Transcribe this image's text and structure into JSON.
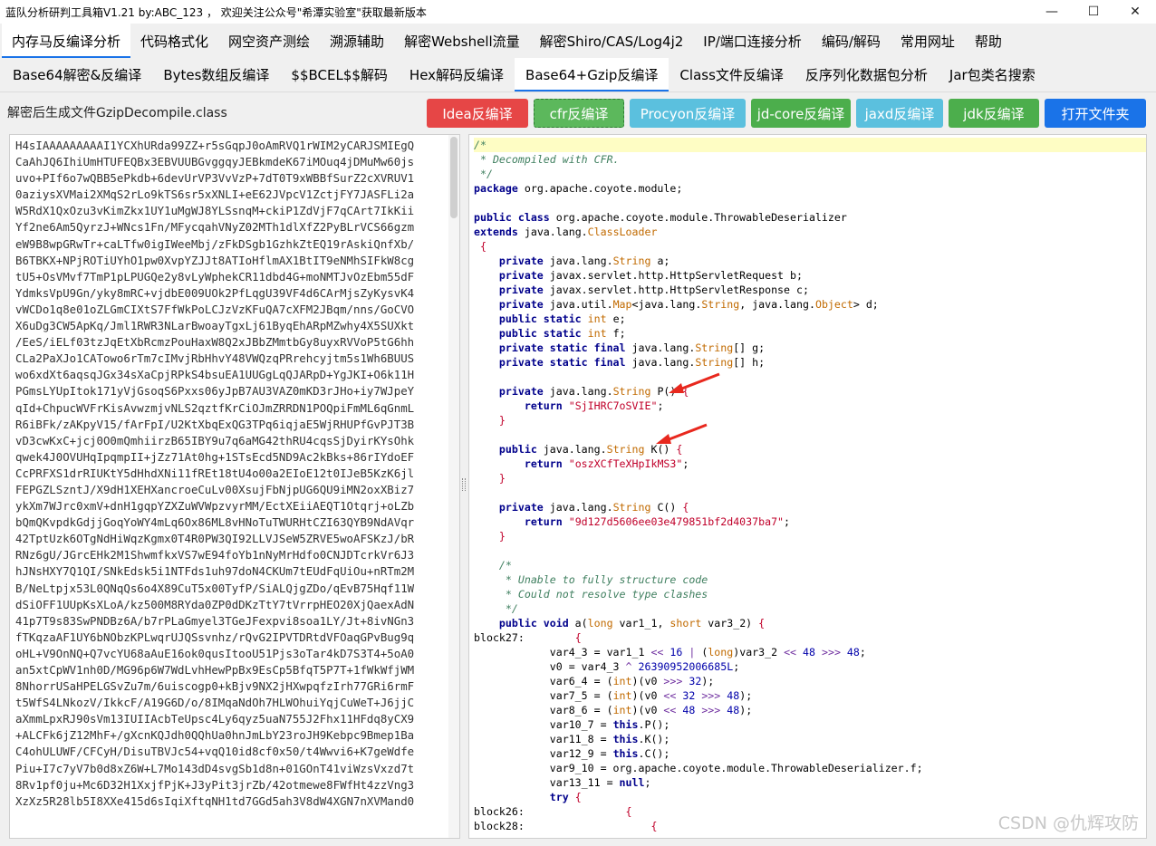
{
  "window": {
    "title": "蓝队分析研判工具箱V1.21 by:ABC_123 ， 欢迎关注公众号\"希潭实验室\"获取最新版本",
    "controls": [
      "—",
      "☐",
      "✕"
    ]
  },
  "menu": [
    "内存马反编译分析",
    "代码格式化",
    "网空资产测绘",
    "溯源辅助",
    "解密Webshell流量",
    "解密Shiro/CAS/Log4j2",
    "IP/端口连接分析",
    "编码/解码",
    "常用网址",
    "帮助"
  ],
  "tabs": [
    "Base64解密&反编译",
    "Bytes数组反编译",
    "$$BCEL$$解码",
    "Hex解码反编译",
    "Base64+Gzip反编译",
    "Class文件反编译",
    "反序列化数据包分析",
    "Jar包类名搜索"
  ],
  "output_label": "解密后生成文件GzipDecompile.class",
  "buttons": [
    {
      "label": "Idea反编译",
      "color": "#e64646",
      "border": "#e64646"
    },
    {
      "label": "cfr反编译",
      "color": "#5cb85c",
      "border": "#2e7d32"
    },
    {
      "label": "Procyon反编译",
      "color": "#5bc0de",
      "border": "#5bc0de"
    },
    {
      "label": "jd-core反编译",
      "color": "#4cae4c",
      "border": "#4cae4c"
    },
    {
      "label": "jaxd反编译",
      "color": "#5bc0de",
      "border": "#5bc0de"
    },
    {
      "label": "jdk反编译",
      "color": "#4cae4c",
      "border": "#4cae4c"
    },
    {
      "label": "打开文件夹",
      "color": "#1a73e8",
      "border": "#1a73e8"
    }
  ],
  "input_text": [
    "H4sIAAAAAAAAAI1YCXhURda99ZZ+r5sGqpJ0oAmRVQ1rWIM2yCARJSMIEgQ",
    "CaAhJQ6IhiUmHTUFEQBx3EBVUUBGvggqyJEBkmdeK67iMOuq4jDMuMw60js",
    "uvo+PIf6o7wQBB5ePkdb+6devUrVP3VvVzP+7dT0T9xWBBfSurZ2cXVRUV1",
    "0aziysXVMai2XMqS2rLo9kTS6sr5xXNLI+eE62JVpcV1ZctjFY7JASFLi2a",
    "W5RdX1QxOzu3vKimZkx1UY1uMgWJ8YLSsnqM+ckiP1ZdVjF7qCArt7IkKii",
    "Yf2ne6Am5QyrzJ+WNcs1Fn/MFycqahVNyZ02MTh1dlXfZ2PyBLrVCS66gzm",
    "eW9B8wpGRwTr+caLTfw0igIWeeMbj/zFkDSgb1GzhkZtEQ19rAskiQnfXb/",
    "B6TBKX+NPjROTiUYhO1pw0XvpYZJJt8ATIoHflmAX1BtIT9eNMhSIFkW8cg",
    "tU5+OsVMvf7TmP1pLPUGQe2y8vLyWphekCR11dbd4G+moNMTJvOzEbm55dF",
    "YdmksVpU9Gn/yky8mRC+vjdbE009UOk2PfLqgU39VF4d6CArMjsZyKysvK4",
    "vWCDo1q8e01oZLGmCIXtS7FfWkPoLCJzVzKFuQA7cXFM2JBqm/nns/GoCVO",
    "X6uDg3CW5ApKq/Jml1RWR3NLarBwoayTgxLj61ByqEhARpMZwhy4X5SUXkt",
    "/EeS/iELf03tzJqEtXbRcmzPouHaxW8Q2xJBbZMmtbGy8uyxRVVoP5tG6hh",
    "CLa2PaXJo1CATowo6rTm7cIMvjRbHhvY48VWQzqPRrehcyjtm5s1Wh6BUUS",
    "wo6xdXt6aqsqJGx34sXaCpjRPkS4bsuEA1UUGgLqQJARpD+YgJKI+O6k11H",
    "PGmsLYUpItok171yVjGsoqS6Pxxs06yJpB7AU3VAZ0mKD3rJHo+iy7WJpeY",
    "qId+ChpucWVFrKisAvwzmjvNLS2qztfKrCiOJmZRRDN1POQpiFmML6qGnmL",
    "R6iBFk/zAKpyV15/fArFpI/U2KtXbqExQG3TPq6iqjaE5WjRHUPfGvPJT3B",
    "vD3cwKxC+jcj0O0mQmhiirzB65IBY9u7q6aMG42thRU4cqsSjDyirKYsOhk",
    "qwek4J0OVUHqIpqmpII+jZz71At0hg+1STsEcd5ND9Ac2kBks+86rIYdoEF",
    "CcPRFXS1drRIUKtY5dHhdXNi11fREt18tU4o00a2EIoE12t0IJeB5KzK6jl",
    "FEPGZLSzntJ/X9dH1XEHXancroeCuLv00XsujFbNjpUG6QU9iMN2oxXBiz7",
    "ykXm7WJrc0xmV+dnH1gqpYZXZuWVWpzvyrMM/EctXEiiAEQT1Otqrj+oLZb",
    "bQmQKvpdkGdjjGoqYoWY4mLq6Ox86ML8vHNoTuTWURHtCZI63QYB9NdAVqr",
    "42TptUzk6OTgNdHiWqzKgmx0T4R0PW3QI92LLVJSeW5ZRVE5woAFSKzJ/bR",
    "RNz6gU/JGrcEHk2M1ShwmfkxVS7wE94foYb1nNyMrHdfo0CNJDTcrkVr6J3",
    "hJNsHXY7Q1QI/SNkEdsk5i1NTFds1uh97doN4CKUm7tEUdFqUiOu+nRTm2M",
    "B/NeLtpjx53L0QNqQs6o4X89CuT5x00TyfP/SiALQjgZDo/qEvB75Hqf11W",
    "dSiOFF1UUpKsXLoA/kz500M8RYda0ZP0dDKzTtY7tVrrpHEO20XjQaexAdN",
    "41p7T9s83SwPNDBz6A/b7rPLaGmyel3TGeJFexpvi8soa1LY/Jt+8ivNGn3",
    "fTKqzaAF1UY6bNObzKPLwqrUJQSsvnhz/rQvG2IPVTDRtdVFOaqGPvBug9q",
    "oHL+V9OnNQ+Q7vcYU68aAuE16ok0qusItooU51Pjs3oTar4kD7S3T4+5oA0",
    "an5xtCpWV1nh0D/MG96p6W7WdLvhHewPpBx9EsCp5BfqT5P7T+1fWkWfjWM",
    "8NhorrUSaHPELGSvZu7m/6uiscogp0+kBjv9NX2jHXwpqfzIrh77GRi6rmF",
    "t5WfS4LNkozV/IkkcF/A19G6D/o/8IMqaNdOh7HLWOhuiYqjCuWeT+J6jjC",
    "aXmmLpxRJ90sVm13IUIIAcbTeUpsc4Ly6qyz5uaN755J2Fhx11HFdq8yCX9",
    "+ALCFk6jZ12MhF+/gXcnKQJdh0QQhUa0hnJmLbY23roJH9Kebpc9Bmep1Ba",
    "C4ohULUWF/CFCyH/DisuTBVJc54+vqQ10id8cf0x50/t4Wwvi6+K7geWdfe",
    "Piu+I7c7yV7b0d8xZ6W+L7Mo143dD4svgSb1d8n+01GOnT41viWzsVxzd7t",
    "8Rv1pf0ju+Mc6D32H1XxjfPjK+J3yPit3jrZb/42otmewe8FWfHt4zzVng3",
    "XzXz5R28lb5I8XXe415d6sIqiXftqNH1td7GGd5ah3V8dW4XGN7nXVMand0"
  ],
  "code_lines": [
    [
      [
        "cm",
        "/*"
      ]
    ],
    [
      [
        "cm",
        " * Decompiled with CFR."
      ]
    ],
    [
      [
        "cm",
        " */"
      ]
    ],
    [
      [
        "kw",
        "package"
      ],
      [
        "p",
        " org.apache.coyote.module;"
      ]
    ],
    [],
    [
      [
        "kw",
        "public class"
      ],
      [
        "p",
        " org.apache.coyote.module.ThrowableDeserializer"
      ]
    ],
    [
      [
        "kw",
        "extends"
      ],
      [
        "p",
        " java.lang."
      ],
      [
        "ty",
        "ClassLoader"
      ]
    ],
    [
      [
        "st",
        " {"
      ]
    ],
    [
      [
        "p",
        "    "
      ],
      [
        "kw",
        "private"
      ],
      [
        "p",
        " java.lang."
      ],
      [
        "ty",
        "String"
      ],
      [
        "p",
        " a;"
      ]
    ],
    [
      [
        "p",
        "    "
      ],
      [
        "kw",
        "private"
      ],
      [
        "p",
        " javax.servlet.http.HttpServletRequest b;"
      ]
    ],
    [
      [
        "p",
        "    "
      ],
      [
        "kw",
        "private"
      ],
      [
        "p",
        " javax.servlet.http.HttpServletResponse c;"
      ]
    ],
    [
      [
        "p",
        "    "
      ],
      [
        "kw",
        "private"
      ],
      [
        "p",
        " java.util."
      ],
      [
        "ty",
        "Map"
      ],
      [
        "p",
        "<java.lang."
      ],
      [
        "ty",
        "String"
      ],
      [
        "p",
        ", java.lang."
      ],
      [
        "ty",
        "Object"
      ],
      [
        "p",
        "> d;"
      ]
    ],
    [
      [
        "p",
        "    "
      ],
      [
        "kw",
        "public static"
      ],
      [
        "p",
        " "
      ],
      [
        "ty",
        "int"
      ],
      [
        "p",
        " e;"
      ]
    ],
    [
      [
        "p",
        "    "
      ],
      [
        "kw",
        "public static"
      ],
      [
        "p",
        " "
      ],
      [
        "ty",
        "int"
      ],
      [
        "p",
        " f;"
      ]
    ],
    [
      [
        "p",
        "    "
      ],
      [
        "kw",
        "private static final"
      ],
      [
        "p",
        " java.lang."
      ],
      [
        "ty",
        "String"
      ],
      [
        "p",
        "[] g;"
      ]
    ],
    [
      [
        "p",
        "    "
      ],
      [
        "kw",
        "private static final"
      ],
      [
        "p",
        " java.lang."
      ],
      [
        "ty",
        "String"
      ],
      [
        "p",
        "[] h;"
      ]
    ],
    [],
    [
      [
        "p",
        "    "
      ],
      [
        "kw",
        "private"
      ],
      [
        "p",
        " java.lang."
      ],
      [
        "ty",
        "String"
      ],
      [
        "p",
        " P() "
      ],
      [
        "st",
        "{"
      ]
    ],
    [
      [
        "p",
        "        "
      ],
      [
        "kw",
        "return"
      ],
      [
        "p",
        " "
      ],
      [
        "st",
        "\"SjIHRC7oSVIE\""
      ],
      [
        "p",
        ";"
      ]
    ],
    [
      [
        "st",
        "    }"
      ]
    ],
    [],
    [
      [
        "p",
        "    "
      ],
      [
        "kw",
        "public"
      ],
      [
        "p",
        " java.lang."
      ],
      [
        "ty",
        "String"
      ],
      [
        "p",
        " K() "
      ],
      [
        "st",
        "{"
      ]
    ],
    [
      [
        "p",
        "        "
      ],
      [
        "kw",
        "return"
      ],
      [
        "p",
        " "
      ],
      [
        "st",
        "\"oszXCfTeXHpIkMS3\""
      ],
      [
        "p",
        ";"
      ]
    ],
    [
      [
        "st",
        "    }"
      ]
    ],
    [],
    [
      [
        "p",
        "    "
      ],
      [
        "kw",
        "private"
      ],
      [
        "p",
        " java.lang."
      ],
      [
        "ty",
        "String"
      ],
      [
        "p",
        " C() "
      ],
      [
        "st",
        "{"
      ]
    ],
    [
      [
        "p",
        "        "
      ],
      [
        "kw",
        "return"
      ],
      [
        "p",
        " "
      ],
      [
        "st",
        "\"9d127d5606ee03e479851bf2d4037ba7\""
      ],
      [
        "p",
        ";"
      ]
    ],
    [
      [
        "st",
        "    }"
      ]
    ],
    [],
    [
      [
        "cm",
        "    /*"
      ]
    ],
    [
      [
        "cm",
        "     * Unable to fully structure code"
      ]
    ],
    [
      [
        "cm",
        "     * Could not resolve type clashes"
      ]
    ],
    [
      [
        "cm",
        "     */"
      ]
    ],
    [
      [
        "p",
        "    "
      ],
      [
        "kw",
        "public void"
      ],
      [
        "p",
        " a("
      ],
      [
        "ty",
        "long"
      ],
      [
        "p",
        " var1_1, "
      ],
      [
        "ty",
        "short"
      ],
      [
        "p",
        " var3_2) "
      ],
      [
        "st",
        "{"
      ]
    ],
    [
      [
        "p",
        "block27:        "
      ],
      [
        "st",
        "{"
      ]
    ],
    [
      [
        "p",
        "            var4_3 = var1_1 "
      ],
      [
        "op",
        "<<"
      ],
      [
        "p",
        " "
      ],
      [
        "nm",
        "16"
      ],
      [
        "p",
        " "
      ],
      [
        "op",
        "|"
      ],
      [
        "p",
        " ("
      ],
      [
        "ty",
        "long"
      ],
      [
        "p",
        ")var3_2 "
      ],
      [
        "op",
        "<<"
      ],
      [
        "p",
        " "
      ],
      [
        "nm",
        "48"
      ],
      [
        "p",
        " "
      ],
      [
        "op",
        ">>>"
      ],
      [
        "p",
        " "
      ],
      [
        "nm",
        "48"
      ],
      [
        "p",
        ";"
      ]
    ],
    [
      [
        "p",
        "            v0 = var4_3 "
      ],
      [
        "op",
        "^"
      ],
      [
        "p",
        " "
      ],
      [
        "nm",
        "26390952006685L"
      ],
      [
        "p",
        ";"
      ]
    ],
    [
      [
        "p",
        "            var6_4 = ("
      ],
      [
        "ty",
        "int"
      ],
      [
        "p",
        ")(v0 "
      ],
      [
        "op",
        ">>>"
      ],
      [
        "p",
        " "
      ],
      [
        "nm",
        "32"
      ],
      [
        "p",
        ");"
      ]
    ],
    [
      [
        "p",
        "            var7_5 = ("
      ],
      [
        "ty",
        "int"
      ],
      [
        "p",
        ")(v0 "
      ],
      [
        "op",
        "<<"
      ],
      [
        "p",
        " "
      ],
      [
        "nm",
        "32"
      ],
      [
        "p",
        " "
      ],
      [
        "op",
        ">>>"
      ],
      [
        "p",
        " "
      ],
      [
        "nm",
        "48"
      ],
      [
        "p",
        ");"
      ]
    ],
    [
      [
        "p",
        "            var8_6 = ("
      ],
      [
        "ty",
        "int"
      ],
      [
        "p",
        ")(v0 "
      ],
      [
        "op",
        "<<"
      ],
      [
        "p",
        " "
      ],
      [
        "nm",
        "48"
      ],
      [
        "p",
        " "
      ],
      [
        "op",
        ">>>"
      ],
      [
        "p",
        " "
      ],
      [
        "nm",
        "48"
      ],
      [
        "p",
        ");"
      ]
    ],
    [
      [
        "p",
        "            var10_7 = "
      ],
      [
        "kw",
        "this"
      ],
      [
        "p",
        ".P();"
      ]
    ],
    [
      [
        "p",
        "            var11_8 = "
      ],
      [
        "kw",
        "this"
      ],
      [
        "p",
        ".K();"
      ]
    ],
    [
      [
        "p",
        "            var12_9 = "
      ],
      [
        "kw",
        "this"
      ],
      [
        "p",
        ".C();"
      ]
    ],
    [
      [
        "p",
        "            var9_10 = org.apache.coyote.module.ThrowableDeserializer.f;"
      ]
    ],
    [
      [
        "p",
        "            var13_11 = "
      ],
      [
        "kw",
        "null"
      ],
      [
        "p",
        ";"
      ]
    ],
    [
      [
        "p",
        "            "
      ],
      [
        "kw",
        "try"
      ],
      [
        "p",
        " "
      ],
      [
        "st",
        "{"
      ]
    ],
    [
      [
        "p",
        "block26:                "
      ],
      [
        "st",
        "{"
      ]
    ],
    [
      [
        "p",
        "block28:                    "
      ],
      [
        "st",
        "{"
      ]
    ]
  ],
  "watermark": "CSDN @仇辉攻防"
}
